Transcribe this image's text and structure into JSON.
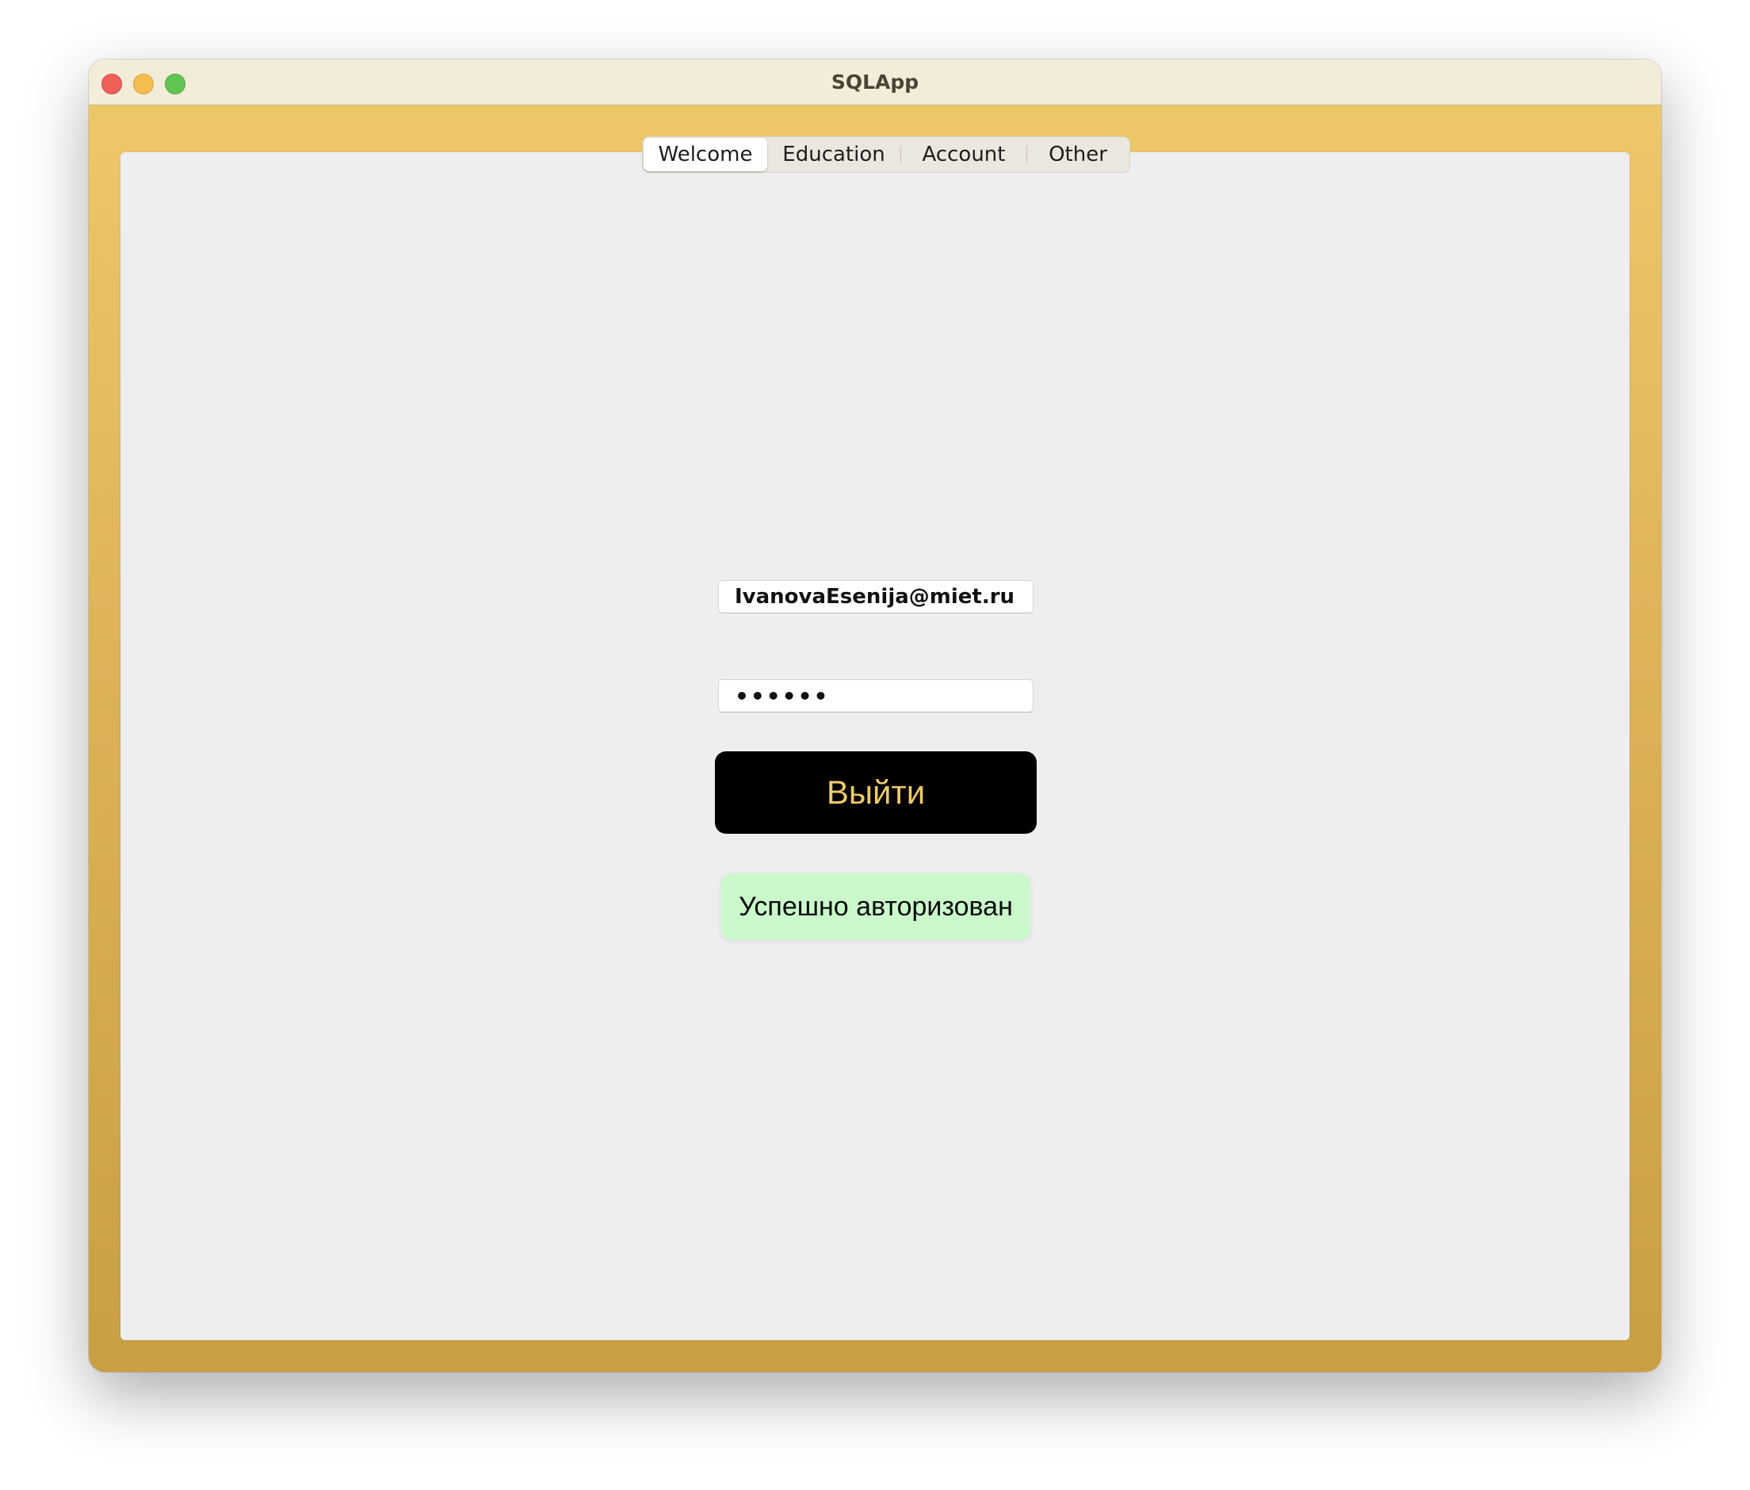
{
  "window": {
    "title": "SQLApp"
  },
  "tabs": [
    {
      "label": "Welcome",
      "selected": true
    },
    {
      "label": "Education",
      "selected": false
    },
    {
      "label": "Account",
      "selected": false
    },
    {
      "label": "Other",
      "selected": false
    }
  ],
  "login": {
    "email_value": "IvanovaEsenija@miet.ru",
    "password_value": "••••••",
    "logout_label": "Выйти",
    "status_text": "Успешно авторизован"
  },
  "colors": {
    "accent": "#eec96a",
    "button_bg": "#000000",
    "success_bg": "#c9f8cb"
  }
}
